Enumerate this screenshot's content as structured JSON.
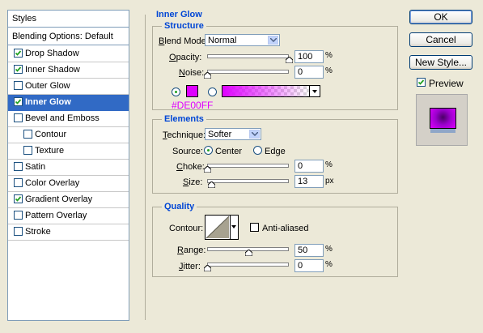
{
  "styles_panel": {
    "header": "Styles",
    "blending_options": "Blending Options: Default",
    "items": [
      {
        "label": "Drop Shadow",
        "checked": true,
        "indent": false,
        "selected": false
      },
      {
        "label": "Inner Shadow",
        "checked": true,
        "indent": false,
        "selected": false
      },
      {
        "label": "Outer Glow",
        "checked": false,
        "indent": false,
        "selected": false
      },
      {
        "label": "Inner Glow",
        "checked": true,
        "indent": false,
        "selected": true
      },
      {
        "label": "Bevel and Emboss",
        "checked": false,
        "indent": false,
        "selected": false
      },
      {
        "label": "Contour",
        "checked": false,
        "indent": true,
        "selected": false
      },
      {
        "label": "Texture",
        "checked": false,
        "indent": true,
        "selected": false
      },
      {
        "label": "Satin",
        "checked": false,
        "indent": false,
        "selected": false
      },
      {
        "label": "Color Overlay",
        "checked": false,
        "indent": false,
        "selected": false
      },
      {
        "label": "Gradient Overlay",
        "checked": true,
        "indent": false,
        "selected": false
      },
      {
        "label": "Pattern Overlay",
        "checked": false,
        "indent": false,
        "selected": false
      },
      {
        "label": "Stroke",
        "checked": false,
        "indent": false,
        "selected": false
      }
    ]
  },
  "inner_glow": {
    "title": "Inner Glow",
    "structure": {
      "title": "Structure",
      "blend_mode_label_u": "B",
      "blend_mode_label_rest": "lend Mode:",
      "blend_mode_value": "Normal",
      "opacity_label_u": "O",
      "opacity_label_rest": "pacity:",
      "opacity_value": "100",
      "opacity_unit": "%",
      "opacity_level": 1.0,
      "noise_label_u": "N",
      "noise_label_rest": "oise:",
      "noise_value": "0",
      "noise_unit": "%",
      "noise_level": 0.0,
      "color_mode": "solid",
      "glow_color": "#DE00FF",
      "color_annotation": "#DE00FF"
    },
    "elements": {
      "title": "Elements",
      "technique_label_u": "T",
      "technique_label_rest": "echnique:",
      "technique_value": "Softer",
      "source_label": "Source:",
      "center_label": "Center",
      "edge_label": "Edge",
      "source_value": "center",
      "choke_label_u": "C",
      "choke_label_rest": "hoke:",
      "choke_value": "0",
      "choke_unit": "%",
      "choke_level": 0.0,
      "size_label_u": "S",
      "size_label_rest": "ize:",
      "size_value": "13",
      "size_unit": "px",
      "size_level": 0.05
    },
    "quality": {
      "title": "Quality",
      "contour_label": "Contour:",
      "anti_aliased_label": "Anti-aliased",
      "anti_aliased": false,
      "range_label_u": "R",
      "range_label_rest": "ange:",
      "range_value": "50",
      "range_unit": "%",
      "range_level": 0.5,
      "jitter_label_u": "J",
      "jitter_label_rest": "itter:",
      "jitter_value": "0",
      "jitter_unit": "%",
      "jitter_level": 0.0
    }
  },
  "buttons": {
    "ok": "OK",
    "cancel": "Cancel",
    "new_style": "New Style...",
    "preview_label": "Preview",
    "preview_checked": true
  },
  "colors": {
    "accent_selection": "#316ac5",
    "group_title": "#0046d5",
    "glow": "#DE00FF",
    "window_bg": "#ece9d8"
  }
}
